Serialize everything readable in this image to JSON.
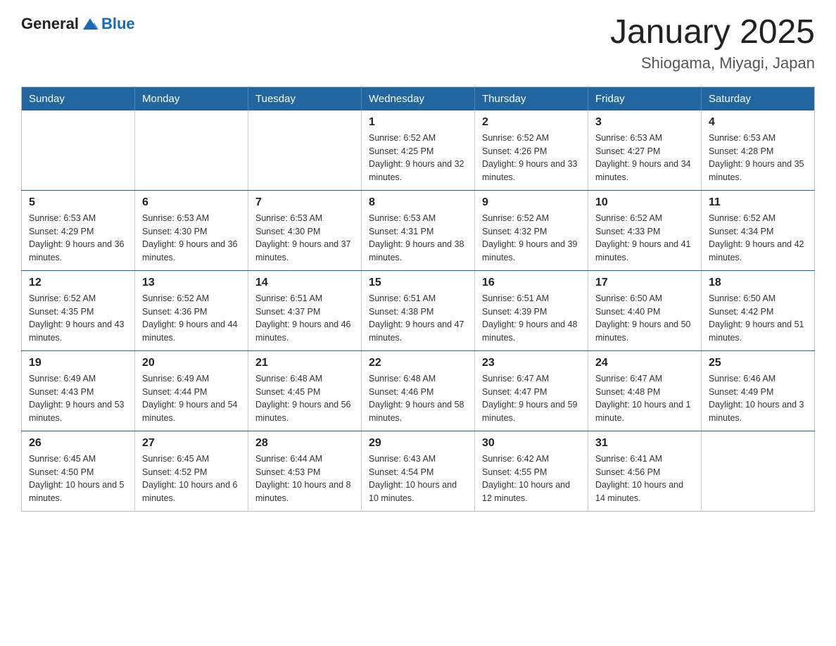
{
  "header": {
    "logo_general": "General",
    "logo_blue": "Blue",
    "title": "January 2025",
    "subtitle": "Shiogama, Miyagi, Japan"
  },
  "weekdays": [
    "Sunday",
    "Monday",
    "Tuesday",
    "Wednesday",
    "Thursday",
    "Friday",
    "Saturday"
  ],
  "weeks": [
    [
      {
        "day": "",
        "info": ""
      },
      {
        "day": "",
        "info": ""
      },
      {
        "day": "",
        "info": ""
      },
      {
        "day": "1",
        "info": "Sunrise: 6:52 AM\nSunset: 4:25 PM\nDaylight: 9 hours and 32 minutes."
      },
      {
        "day": "2",
        "info": "Sunrise: 6:52 AM\nSunset: 4:26 PM\nDaylight: 9 hours and 33 minutes."
      },
      {
        "day": "3",
        "info": "Sunrise: 6:53 AM\nSunset: 4:27 PM\nDaylight: 9 hours and 34 minutes."
      },
      {
        "day": "4",
        "info": "Sunrise: 6:53 AM\nSunset: 4:28 PM\nDaylight: 9 hours and 35 minutes."
      }
    ],
    [
      {
        "day": "5",
        "info": "Sunrise: 6:53 AM\nSunset: 4:29 PM\nDaylight: 9 hours and 36 minutes."
      },
      {
        "day": "6",
        "info": "Sunrise: 6:53 AM\nSunset: 4:30 PM\nDaylight: 9 hours and 36 minutes."
      },
      {
        "day": "7",
        "info": "Sunrise: 6:53 AM\nSunset: 4:30 PM\nDaylight: 9 hours and 37 minutes."
      },
      {
        "day": "8",
        "info": "Sunrise: 6:53 AM\nSunset: 4:31 PM\nDaylight: 9 hours and 38 minutes."
      },
      {
        "day": "9",
        "info": "Sunrise: 6:52 AM\nSunset: 4:32 PM\nDaylight: 9 hours and 39 minutes."
      },
      {
        "day": "10",
        "info": "Sunrise: 6:52 AM\nSunset: 4:33 PM\nDaylight: 9 hours and 41 minutes."
      },
      {
        "day": "11",
        "info": "Sunrise: 6:52 AM\nSunset: 4:34 PM\nDaylight: 9 hours and 42 minutes."
      }
    ],
    [
      {
        "day": "12",
        "info": "Sunrise: 6:52 AM\nSunset: 4:35 PM\nDaylight: 9 hours and 43 minutes."
      },
      {
        "day": "13",
        "info": "Sunrise: 6:52 AM\nSunset: 4:36 PM\nDaylight: 9 hours and 44 minutes."
      },
      {
        "day": "14",
        "info": "Sunrise: 6:51 AM\nSunset: 4:37 PM\nDaylight: 9 hours and 46 minutes."
      },
      {
        "day": "15",
        "info": "Sunrise: 6:51 AM\nSunset: 4:38 PM\nDaylight: 9 hours and 47 minutes."
      },
      {
        "day": "16",
        "info": "Sunrise: 6:51 AM\nSunset: 4:39 PM\nDaylight: 9 hours and 48 minutes."
      },
      {
        "day": "17",
        "info": "Sunrise: 6:50 AM\nSunset: 4:40 PM\nDaylight: 9 hours and 50 minutes."
      },
      {
        "day": "18",
        "info": "Sunrise: 6:50 AM\nSunset: 4:42 PM\nDaylight: 9 hours and 51 minutes."
      }
    ],
    [
      {
        "day": "19",
        "info": "Sunrise: 6:49 AM\nSunset: 4:43 PM\nDaylight: 9 hours and 53 minutes."
      },
      {
        "day": "20",
        "info": "Sunrise: 6:49 AM\nSunset: 4:44 PM\nDaylight: 9 hours and 54 minutes."
      },
      {
        "day": "21",
        "info": "Sunrise: 6:48 AM\nSunset: 4:45 PM\nDaylight: 9 hours and 56 minutes."
      },
      {
        "day": "22",
        "info": "Sunrise: 6:48 AM\nSunset: 4:46 PM\nDaylight: 9 hours and 58 minutes."
      },
      {
        "day": "23",
        "info": "Sunrise: 6:47 AM\nSunset: 4:47 PM\nDaylight: 9 hours and 59 minutes."
      },
      {
        "day": "24",
        "info": "Sunrise: 6:47 AM\nSunset: 4:48 PM\nDaylight: 10 hours and 1 minute."
      },
      {
        "day": "25",
        "info": "Sunrise: 6:46 AM\nSunset: 4:49 PM\nDaylight: 10 hours and 3 minutes."
      }
    ],
    [
      {
        "day": "26",
        "info": "Sunrise: 6:45 AM\nSunset: 4:50 PM\nDaylight: 10 hours and 5 minutes."
      },
      {
        "day": "27",
        "info": "Sunrise: 6:45 AM\nSunset: 4:52 PM\nDaylight: 10 hours and 6 minutes."
      },
      {
        "day": "28",
        "info": "Sunrise: 6:44 AM\nSunset: 4:53 PM\nDaylight: 10 hours and 8 minutes."
      },
      {
        "day": "29",
        "info": "Sunrise: 6:43 AM\nSunset: 4:54 PM\nDaylight: 10 hours and 10 minutes."
      },
      {
        "day": "30",
        "info": "Sunrise: 6:42 AM\nSunset: 4:55 PM\nDaylight: 10 hours and 12 minutes."
      },
      {
        "day": "31",
        "info": "Sunrise: 6:41 AM\nSunset: 4:56 PM\nDaylight: 10 hours and 14 minutes."
      },
      {
        "day": "",
        "info": ""
      }
    ]
  ]
}
